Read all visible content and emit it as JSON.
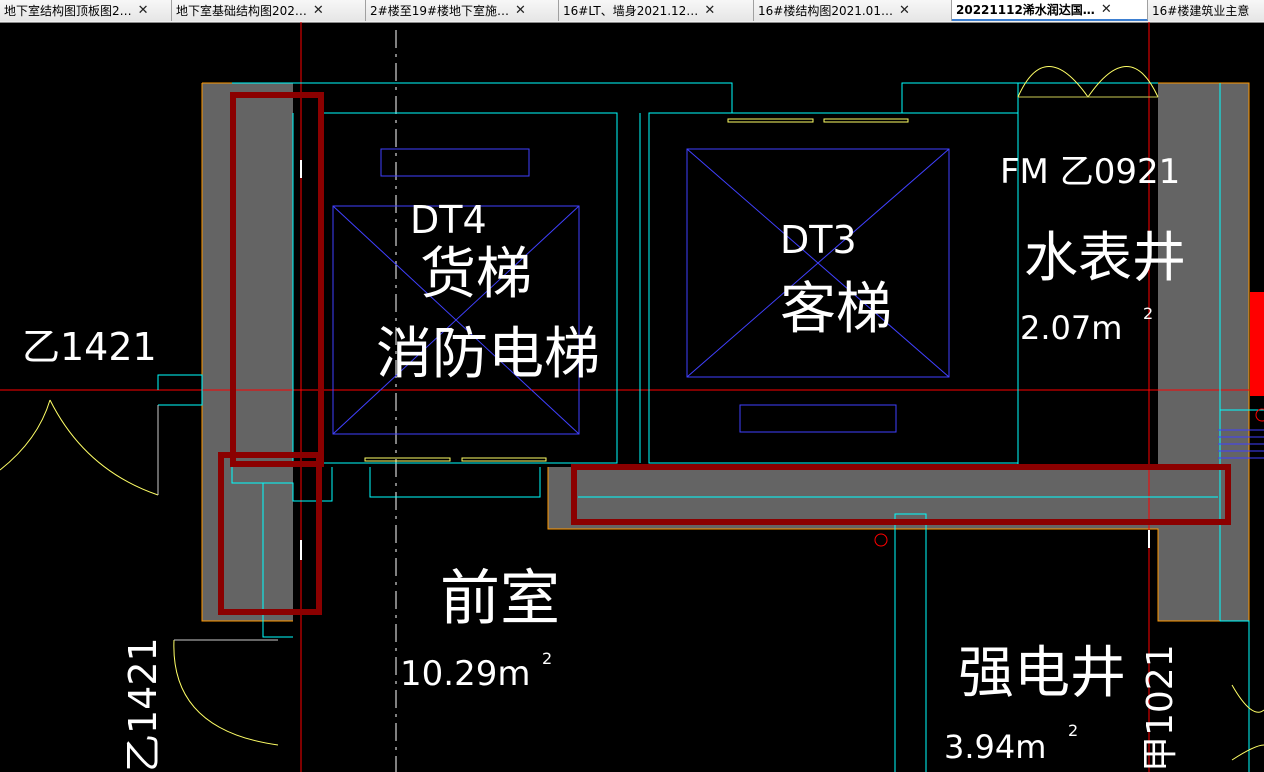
{
  "tabs": [
    {
      "label": "地下室结构图顶板图2…",
      "close": "✕",
      "active": false
    },
    {
      "label": "地下室基础结构图202…",
      "close": "✕",
      "active": false
    },
    {
      "label": "2#楼至19#楼地下室施…",
      "close": "✕",
      "active": false
    },
    {
      "label": "16#LT、墙身2021.12…",
      "close": "✕",
      "active": false
    },
    {
      "label": "16#楼结构图2021.01…",
      "close": "✕",
      "active": false
    },
    {
      "label": "20221112浠水润达国…",
      "close": "✕",
      "active": true
    },
    {
      "label": "16#楼建筑业主意",
      "close": "",
      "active": false
    }
  ],
  "drawing": {
    "dt4_code": "DT4",
    "dt4_name": "货梯",
    "dt4_sub": "消防电梯",
    "dt3_code": "DT3",
    "dt3_name": "客梯",
    "door_fm": "FM 乙0921",
    "water_meter": "水表井",
    "water_area": "2.07m",
    "water_area_sup": "2",
    "door_left": "乙1421",
    "anteroom": "前室",
    "anteroom_area": "10.29m",
    "anteroom_area_sup": "2",
    "electric_shaft": "强电井",
    "electric_area": "3.94m",
    "electric_area_sup": "2",
    "door_left_vertical": "乙1421",
    "door_right_vertical": "甲1021"
  },
  "colors": {
    "background": "#000000",
    "wall_fill": "#646464",
    "highlight": "#8b0000",
    "cyan": "#00ffff",
    "axis_red": "#ff0000",
    "orange": "#ff9900",
    "yellow": "#ffff66",
    "elevator_blue": "#4040ff"
  }
}
